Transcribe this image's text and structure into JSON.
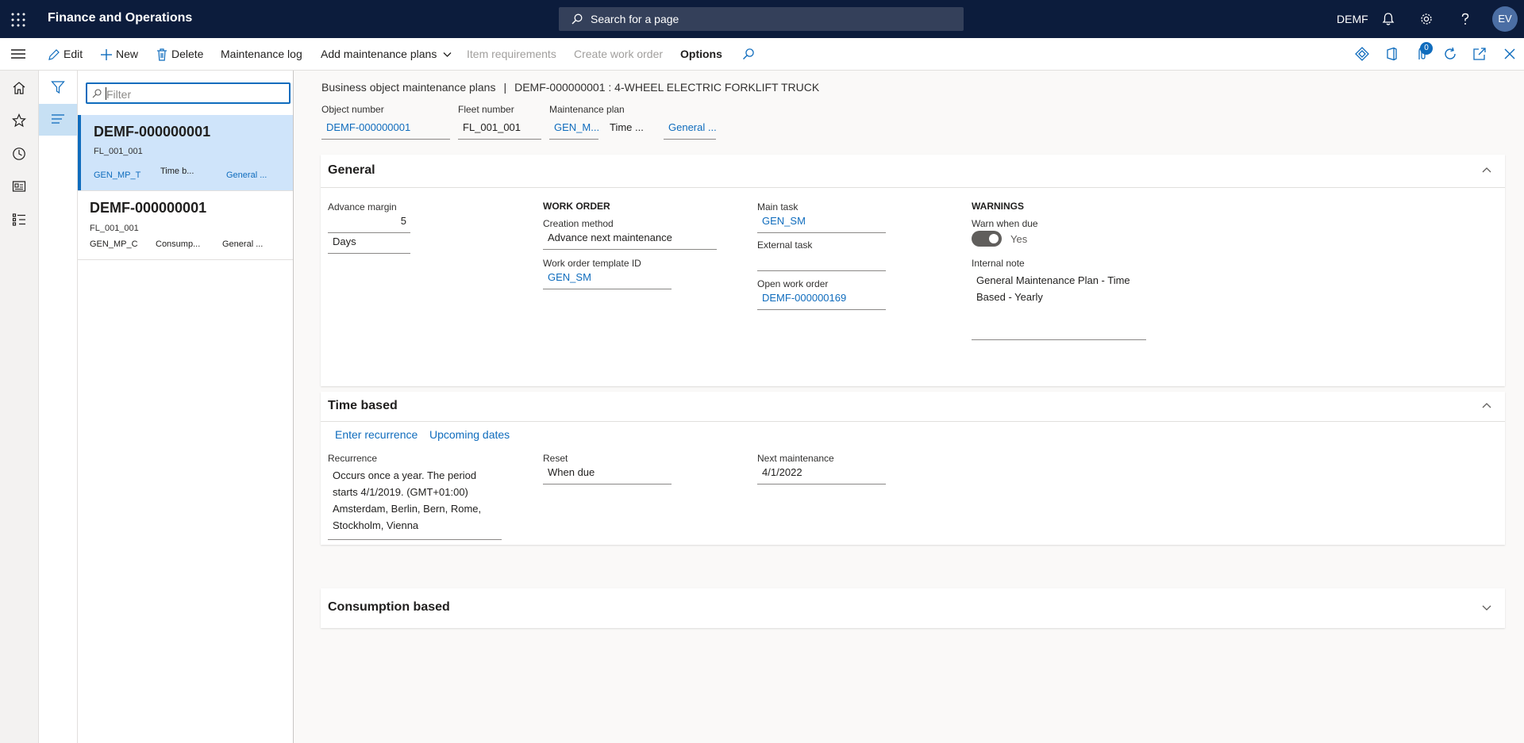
{
  "app": {
    "title": "Finance and Operations",
    "company": "DEMF",
    "avatar_initials": "EV"
  },
  "search": {
    "placeholder": "Search for a page"
  },
  "actions": {
    "edit": "Edit",
    "new": "New",
    "delete": "Delete",
    "maintenance_log": "Maintenance log",
    "add_maintenance_plans": "Add maintenance plans",
    "item_requirements": "Item requirements",
    "create_work_order": "Create work order",
    "options": "Options",
    "notification_count": "0"
  },
  "list": {
    "filter_placeholder": "Filter",
    "records": [
      {
        "id": "DEMF-000000001",
        "fleet": "FL_001_001",
        "plan": "GEN_MP_T",
        "type": "Time b...",
        "desc": "General ..."
      },
      {
        "id": "DEMF-000000001",
        "fleet": "FL_001_001",
        "plan": "GEN_MP_C",
        "type": "Consump...",
        "desc": "General ..."
      }
    ]
  },
  "header": {
    "breadcrumb_section": "Business object maintenance plans",
    "breadcrumb_sep": "|",
    "breadcrumb_record": "DEMF-000000001 : 4-WHEEL ELECTRIC FORKLIFT TRUCK",
    "object_number_label": "Object number",
    "object_number": "DEMF-000000001",
    "fleet_number_label": "Fleet number",
    "fleet_number": "FL_001_001",
    "maintenance_plan_label": "Maintenance plan",
    "maintenance_plan_id": "GEN_M...",
    "maintenance_plan_type": "Time ...",
    "maintenance_plan_desc": "General ..."
  },
  "general": {
    "title": "General",
    "advance_margin_label": "Advance margin",
    "advance_margin": "5",
    "advance_unit": "Days",
    "work_order_heading": "WORK ORDER",
    "creation_method_label": "Creation method",
    "creation_method": "Advance next maintenance",
    "template_label": "Work order template ID",
    "template_id": "GEN_SM",
    "main_task_label": "Main task",
    "main_task": "GEN_SM",
    "external_task_label": "External task",
    "external_task": "",
    "open_work_order_label": "Open work order",
    "open_work_order": "DEMF-000000169",
    "warnings_heading": "WARNINGS",
    "warn_when_due_label": "Warn when due",
    "warn_when_due": "Yes",
    "internal_note_label": "Internal note",
    "internal_note_line1": "General Maintenance Plan - Time",
    "internal_note_line2": "Based - Yearly"
  },
  "time_based": {
    "title": "Time based",
    "enter_recurrence": "Enter recurrence",
    "upcoming_dates": "Upcoming dates",
    "recurrence_label": "Recurrence",
    "recurrence_line1": "Occurs once a year. The period",
    "recurrence_line2": "starts 4/1/2019. (GMT+01:00)",
    "recurrence_line3": "Amsterdam, Berlin, Bern, Rome,",
    "recurrence_line4": "Stockholm, Vienna",
    "reset_label": "Reset",
    "reset": "When due",
    "next_maintenance_label": "Next maintenance",
    "next_maintenance": "4/1/2022"
  },
  "consumption": {
    "title": "Consumption based"
  },
  "colors": {
    "topbar": "#0c1c3c",
    "accent": "#0f6cbd",
    "selected_row": "#cfe4fa"
  }
}
